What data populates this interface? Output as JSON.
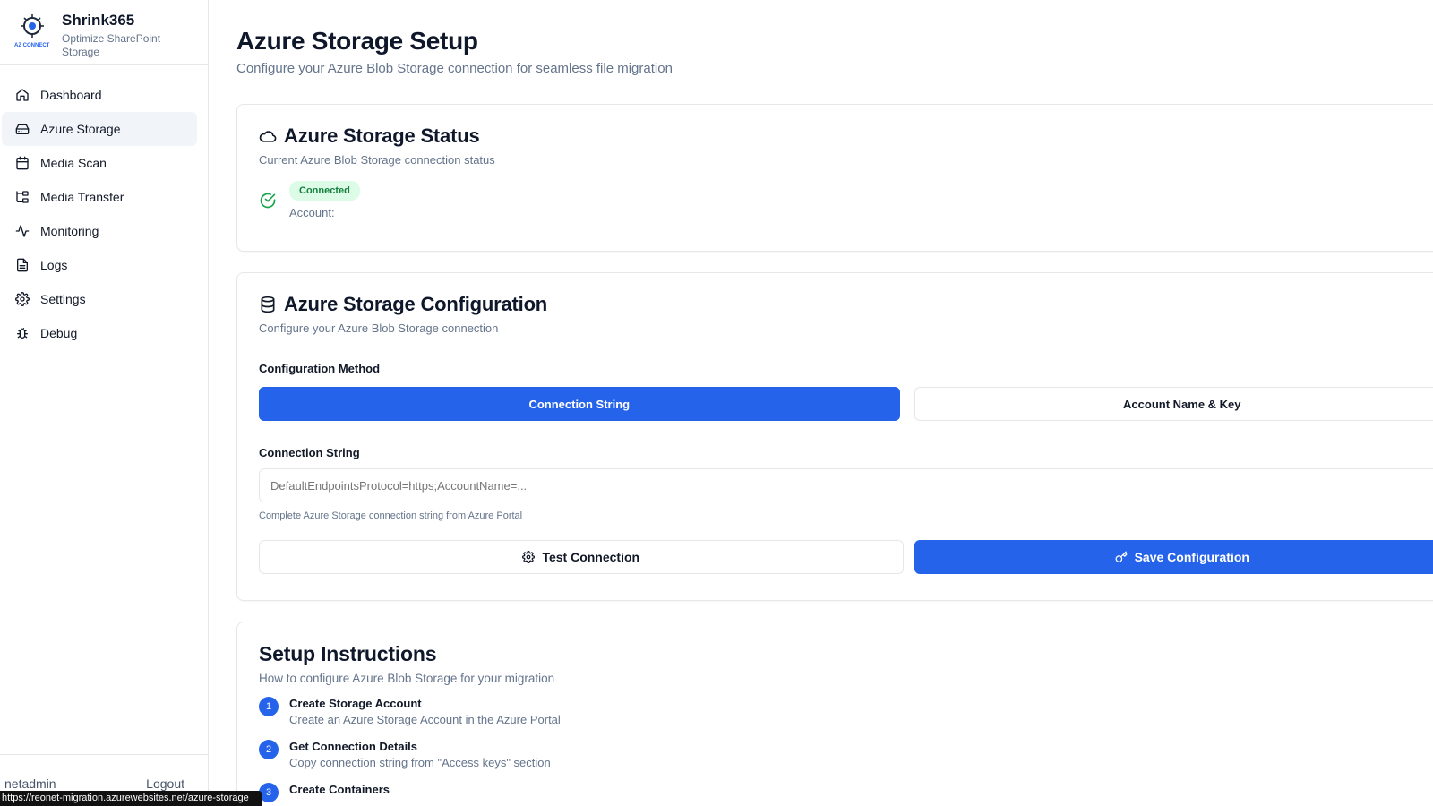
{
  "brand": {
    "name": "Shrink365",
    "subtitle": "Optimize SharePoint Storage",
    "logo_text": "AZ CONNECT"
  },
  "sidebar": {
    "items": [
      {
        "label": "Dashboard",
        "icon": "home-icon",
        "active": false
      },
      {
        "label": "Azure Storage",
        "icon": "hard-drive-icon",
        "active": true
      },
      {
        "label": "Media Scan",
        "icon": "calendar-icon",
        "active": false
      },
      {
        "label": "Media Transfer",
        "icon": "folder-tree-icon",
        "active": false
      },
      {
        "label": "Monitoring",
        "icon": "activity-icon",
        "active": false
      },
      {
        "label": "Logs",
        "icon": "file-text-icon",
        "active": false
      },
      {
        "label": "Settings",
        "icon": "gear-icon",
        "active": false
      },
      {
        "label": "Debug",
        "icon": "bug-icon",
        "active": false
      }
    ],
    "footer": {
      "user": "netadmin",
      "logout_label": "Logout"
    }
  },
  "status_url": "https://reonet-migration.azurewebsites.net/azure-storage",
  "page": {
    "title": "Azure Storage Setup",
    "subtitle": "Configure your Azure Blob Storage connection for seamless file migration"
  },
  "status_card": {
    "title": "Azure Storage Status",
    "subtitle": "Current Azure Blob Storage connection status",
    "badge": "Connected",
    "account_label": "Account:"
  },
  "config_card": {
    "title": "Azure Storage Configuration",
    "subtitle": "Configure your Azure Blob Storage connection",
    "method_label": "Configuration Method",
    "methods": [
      {
        "label": "Connection String",
        "selected": true
      },
      {
        "label": "Account Name & Key",
        "selected": false
      }
    ],
    "connection_string_label": "Connection String",
    "connection_string_placeholder": "DefaultEndpointsProtocol=https;AccountName=...",
    "connection_string_hint": "Complete Azure Storage connection string from Azure Portal",
    "test_button": "Test Connection",
    "save_button": "Save Configuration"
  },
  "instructions_card": {
    "title": "Setup Instructions",
    "subtitle": "How to configure Azure Blob Storage for your migration",
    "steps": [
      {
        "num": "1",
        "title": "Create Storage Account",
        "desc": "Create an Azure Storage Account in the Azure Portal"
      },
      {
        "num": "2",
        "title": "Get Connection Details",
        "desc": "Copy connection string from \"Access keys\" section"
      },
      {
        "num": "3",
        "title": "Create Containers",
        "desc": ""
      }
    ]
  },
  "colors": {
    "primary": "#2563eb",
    "success_bg": "#dcfce7",
    "success_text": "#15803d",
    "muted_text": "#64748b",
    "border": "#e5e7eb",
    "active_nav_bg": "#f1f5f9"
  }
}
